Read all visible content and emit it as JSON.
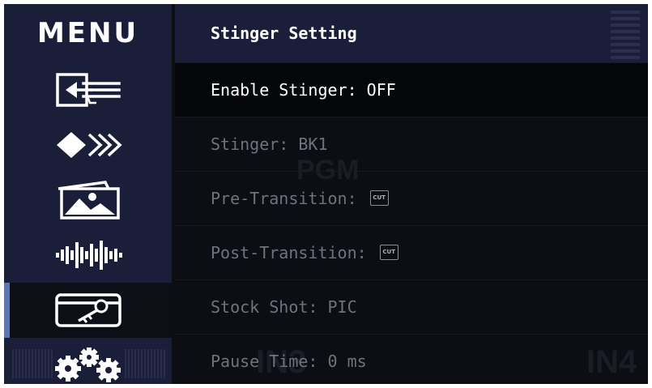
{
  "sidebar": {
    "title": "MENU",
    "items": [
      {
        "icon": "input-switch-icon"
      },
      {
        "icon": "transition-arrows-icon"
      },
      {
        "icon": "picture-icon"
      },
      {
        "icon": "audio-waveform-icon"
      },
      {
        "icon": "stinger-key-icon",
        "active": true
      },
      {
        "icon": "settings-gears-icon"
      }
    ]
  },
  "panel": {
    "header": "Stinger Setting",
    "rows": [
      {
        "label": "Enable Stinger: OFF"
      },
      {
        "label": "Stinger: BK1"
      },
      {
        "label": "Pre-Transition:",
        "badge": "CUT"
      },
      {
        "label": "Post-Transition:",
        "badge": "CUT"
      },
      {
        "label": "Stock Shot: PIC"
      },
      {
        "label": "Pause Time: 0 ms"
      }
    ]
  },
  "background_text": {
    "pgm": "PGM",
    "in3": "IN3",
    "in4": "IN4"
  },
  "colors": {
    "sidebar_bg": "#1b1e38",
    "content_bg": "#0c0e14",
    "active_accent": "#5a78b8",
    "focus_text": "#ffffff",
    "dim_text": "#6f7380"
  }
}
